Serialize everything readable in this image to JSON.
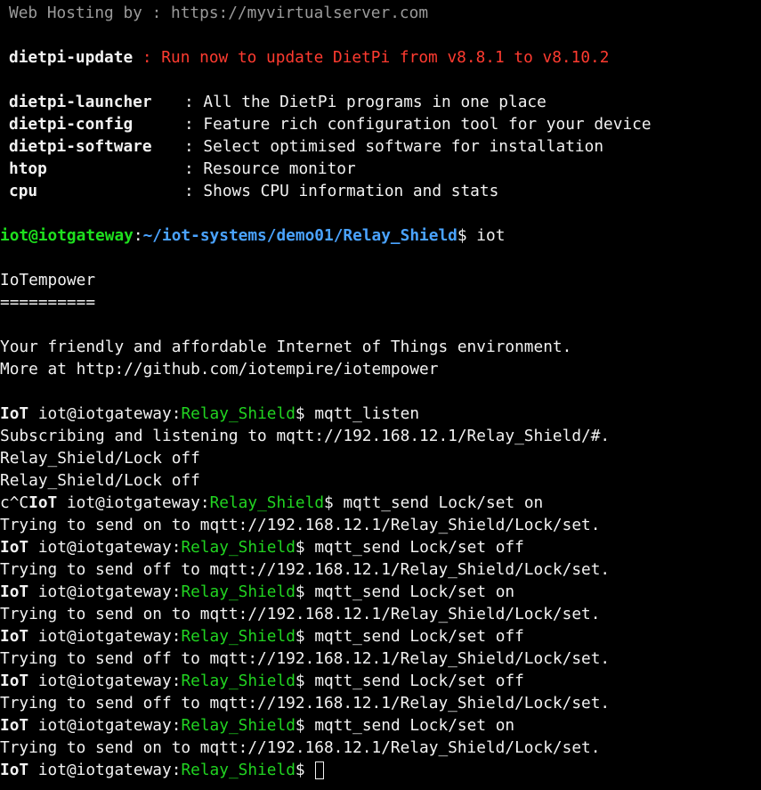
{
  "banner": {
    "hosting_label": "Web Hosting by",
    "hosting_sep": " : ",
    "hosting_url": "https://myvirtualserver.com",
    "update_cmd": "dietpi-update",
    "update_sep": " : ",
    "update_text": "Run now to update DietPi from v8.8.1 to v8.10.2",
    "commands": [
      {
        "cmd": "dietpi-launcher",
        "sep": ": ",
        "desc": "All the DietPi programs in one place"
      },
      {
        "cmd": "dietpi-config",
        "sep": ": ",
        "desc": "Feature rich configuration tool for your device"
      },
      {
        "cmd": "dietpi-software",
        "sep": ": ",
        "desc": "Select optimised software for installation"
      },
      {
        "cmd": "htop",
        "sep": ": ",
        "desc": "Resource monitor"
      },
      {
        "cmd": "cpu",
        "sep": ": ",
        "desc": "Shows CPU information and stats"
      }
    ]
  },
  "shell_prompt": {
    "user_host": "iot@iotgateway",
    "colon": ":",
    "path": "~/iot-systems/demo01/Relay_Shield",
    "dollar": "$ ",
    "command": "iot"
  },
  "iot_intro": {
    "title": "IoTempower",
    "underline": "==========",
    "tagline": "Your friendly and affordable Internet of Things environment.",
    "more": "More at http://github.com/iotempire/iotempower"
  },
  "iot_prompt": {
    "prefix": "IoT",
    "user_host": " iot@iotgateway",
    "colon": ":",
    "path": "Relay_Shield",
    "dollar": "$ "
  },
  "session": {
    "cmd_listen": "mqtt_listen",
    "subscribe_msg": "Subscribing and listening to mqtt://192.168.12.1/Relay_Shield/#.",
    "msg_1": "Relay_Shield/Lock off",
    "msg_2": "Relay_Shield/Lock off",
    "ctrl_c": "c^C",
    "cmd_1": "mqtt_send Lock/set on",
    "out_1": "Trying to send on to mqtt://192.168.12.1/Relay_Shield/Lock/set.",
    "cmd_2": "mqtt_send Lock/set off",
    "out_2": "Trying to send off to mqtt://192.168.12.1/Relay_Shield/Lock/set.",
    "cmd_3": "mqtt_send Lock/set on",
    "out_3": "Trying to send on to mqtt://192.168.12.1/Relay_Shield/Lock/set.",
    "cmd_4": "mqtt_send Lock/set off",
    "out_4": "Trying to send off to mqtt://192.168.12.1/Relay_Shield/Lock/set.",
    "cmd_5": "mqtt_send Lock/set off",
    "out_5": "Trying to send off to mqtt://192.168.12.1/Relay_Shield/Lock/set.",
    "cmd_6": "mqtt_send Lock/set on",
    "out_6": "Trying to send on to mqtt://192.168.12.1/Relay_Shield/Lock/set."
  },
  "colors": {
    "background": "#000000",
    "foreground": "#f2f2f2",
    "dim": "#9a9a9a",
    "warning_red": "#ff3b30",
    "prompt_green": "#1ee01e",
    "path_blue": "#4aa3ff"
  }
}
